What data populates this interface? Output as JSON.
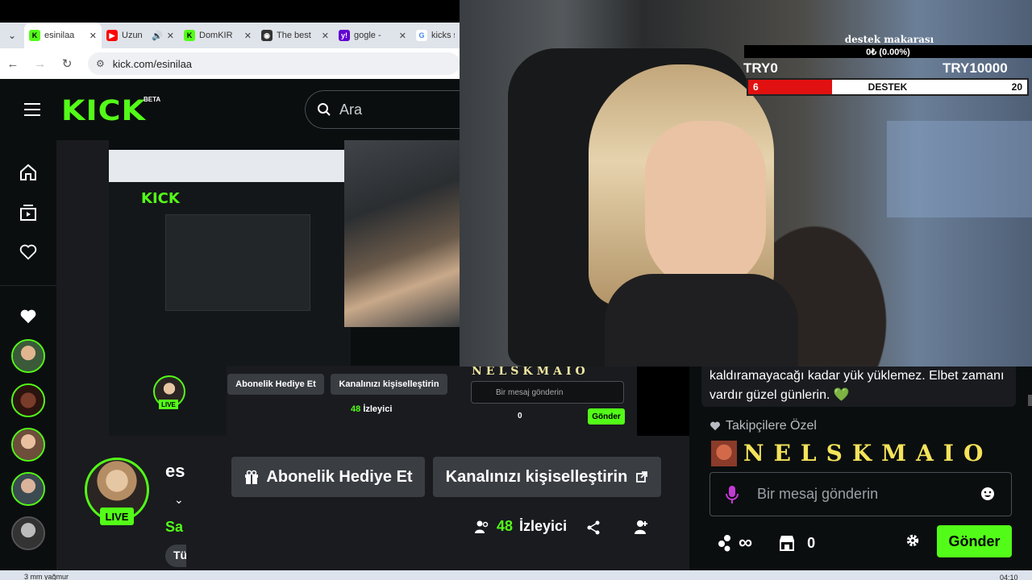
{
  "browser": {
    "tabs": [
      {
        "label": "esinilaa",
        "favicon_color": "#53fc18",
        "favicon_glyph": "K"
      },
      {
        "label": "Uzun",
        "favicon_color": "#ff0000",
        "favicon_glyph": "▶"
      },
      {
        "label": "DomKIR",
        "favicon_color": "#53fc18",
        "favicon_glyph": "K"
      },
      {
        "label": "The best",
        "favicon_color": "#333333",
        "favicon_glyph": "◉"
      },
      {
        "label": "gogle -",
        "favicon_color": "#6001d2",
        "favicon_glyph": "y!"
      },
      {
        "label": "kicks s",
        "favicon_color": "#4285f4",
        "favicon_glyph": "G"
      }
    ],
    "url": "kick.com/esinilaa"
  },
  "kick": {
    "logo": "KICK",
    "beta": "BETA",
    "search_placeholder": "Ara",
    "accent": "#53fc18"
  },
  "nested_preview": {
    "gift_label": "Abonelik Hediye Et",
    "customize_label": "Kanalınızı kişiselleştirin",
    "viewers": "48",
    "viewers_label": "İzleyici",
    "chat_placeholder": "Bir mesaj gönderin",
    "send_label": "Gönder",
    "banner": "NELSKMAIO",
    "live": "LIVE",
    "sub_count": "0"
  },
  "channel": {
    "name": "es",
    "category": "Sa",
    "tag": "Tü",
    "live": "LIVE",
    "gift_label": "Abonelik Hediye Et",
    "customize_label": "Kanalınızı kişiselleştirin",
    "viewers": "48",
    "viewers_label": "İzleyici"
  },
  "goal": {
    "title": "destek makarası",
    "summary": "0₺ (0.00%)",
    "min": "TRY0",
    "max": "TRY10000",
    "left_value": "6",
    "label": "DESTEK",
    "right_value": "20",
    "fill_fraction": 0.3
  },
  "chat": {
    "message": "kaldıramayacağı kadar yük yüklemez. Elbet zamanı vardır güzel günlerin.",
    "heart": "💚",
    "follower_only": "Takipçilere Özel",
    "banner": "NELSKMAIO",
    "placeholder": "Bir mesaj gönderin",
    "sub_count": "0",
    "send_label": "Gönder"
  },
  "taskbar": {
    "weather": "3 mm yağmur",
    "clock": "04:10"
  }
}
